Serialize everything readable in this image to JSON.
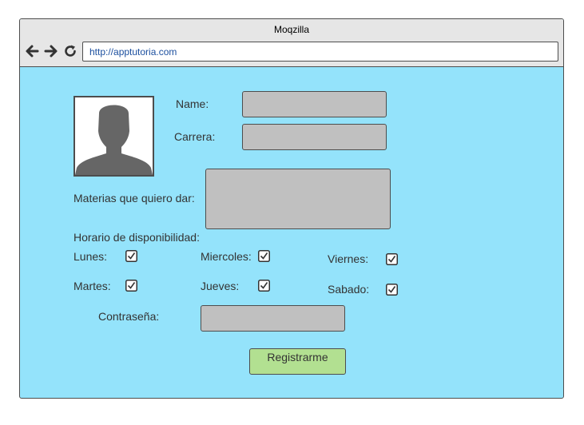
{
  "browser": {
    "title": "Moqzilla",
    "url": "http://apptutoria.com"
  },
  "form": {
    "name_label": "Name:",
    "carrera_label": "Carrera:",
    "materias_label": "Materias que quiero dar:",
    "horario_label": "Horario de disponibilidad:",
    "days": [
      {
        "label": "Lunes:",
        "checked": true
      },
      {
        "label": "Miercoles:",
        "checked": true
      },
      {
        "label": "Viernes:",
        "checked": true
      },
      {
        "label": "Martes:",
        "checked": true
      },
      {
        "label": "Jueves:",
        "checked": true
      },
      {
        "label": "Sabado:",
        "checked": true
      }
    ],
    "password_label": "Contraseña:",
    "submit_label": "Registrarme"
  },
  "colors": {
    "page_background": "#94e3fb",
    "field_fill": "#c0c0c0",
    "button_fill": "#b2e091",
    "avatar_silhouette": "#666666",
    "url_text": "#1a4e9e"
  },
  "icons": [
    "back-arrow-icon",
    "forward-arrow-icon",
    "reload-icon",
    "user-silhouette-icon",
    "checkbox-checked-icon"
  ]
}
